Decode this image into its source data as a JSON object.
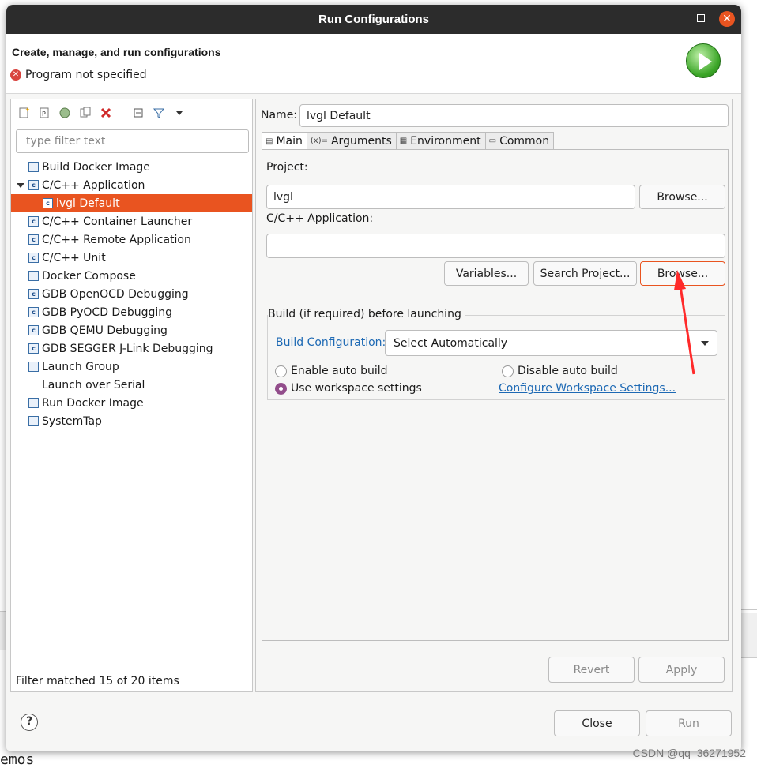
{
  "dialog": {
    "title": "Run Configurations",
    "header_title": "Create, manage, and run configurations",
    "header_message": "Program not specified",
    "close_glyph": "✕"
  },
  "left": {
    "filter_placeholder": "type filter text",
    "tree": [
      {
        "label": "Build Docker Image",
        "icon": "docker-build-icon",
        "level": 1
      },
      {
        "label": "C/C++ Application",
        "icon": "c-app-icon",
        "level": 1,
        "expanded": true
      },
      {
        "label": "lvgl Default",
        "icon": "c-app-icon",
        "level": 2,
        "selected": true
      },
      {
        "label": "C/C++ Container Launcher",
        "icon": "c-app-icon",
        "level": 1
      },
      {
        "label": "C/C++ Remote Application",
        "icon": "c-app-icon",
        "level": 1
      },
      {
        "label": "C/C++ Unit",
        "icon": "c-unit-icon",
        "level": 1
      },
      {
        "label": "Docker Compose",
        "icon": "docker-compose-icon",
        "level": 1
      },
      {
        "label": "GDB OpenOCD Debugging",
        "icon": "c-app-icon",
        "level": 1
      },
      {
        "label": "GDB PyOCD Debugging",
        "icon": "c-app-icon",
        "level": 1
      },
      {
        "label": "GDB QEMU Debugging",
        "icon": "c-app-icon",
        "level": 1
      },
      {
        "label": "GDB SEGGER J-Link Debugging",
        "icon": "c-app-icon",
        "level": 1
      },
      {
        "label": "Launch Group",
        "icon": "launch-group-icon",
        "level": 1
      },
      {
        "label": "Launch over Serial",
        "icon": "",
        "level": 1
      },
      {
        "label": "Run Docker Image",
        "icon": "docker-run-icon",
        "level": 1
      },
      {
        "label": "SystemTap",
        "icon": "systemtap-icon",
        "level": 1
      }
    ],
    "status": "Filter matched 15 of 20 items"
  },
  "right": {
    "name_label": "Name:",
    "name_value": "lvgl Default",
    "tabs": [
      {
        "label": "Main",
        "icon": "main-tab-icon",
        "glyph": "▤"
      },
      {
        "label": "Arguments",
        "icon": "arguments-tab-icon",
        "glyph": "(x)="
      },
      {
        "label": "Environment",
        "icon": "environment-tab-icon",
        "glyph": "▦"
      },
      {
        "label": "Common",
        "icon": "common-tab-icon",
        "glyph": "▭"
      }
    ],
    "project_label": "Project:",
    "project_value": "lvgl",
    "browse_label": "Browse...",
    "app_label": "C/C++ Application:",
    "app_value": "",
    "variables_label": "Variables...",
    "search_project_label": "Search Project...",
    "browse2_label": "Browse...",
    "build_group_title": "Build (if required) before launching",
    "build_config_link": "Build Configuration:",
    "build_config_value": "Select Automatically",
    "radio_enable": "Enable auto build",
    "radio_disable": "Disable auto build",
    "radio_workspace": "Use workspace settings",
    "configure_link": "Configure Workspace Settings...",
    "revert_label": "Revert",
    "apply_label": "Apply"
  },
  "footer": {
    "help_glyph": "?",
    "close_label": "Close",
    "run_label": "Run"
  },
  "background": {
    "bottom_text": "emos",
    "watermark": "CSDN @qq_36271952"
  }
}
